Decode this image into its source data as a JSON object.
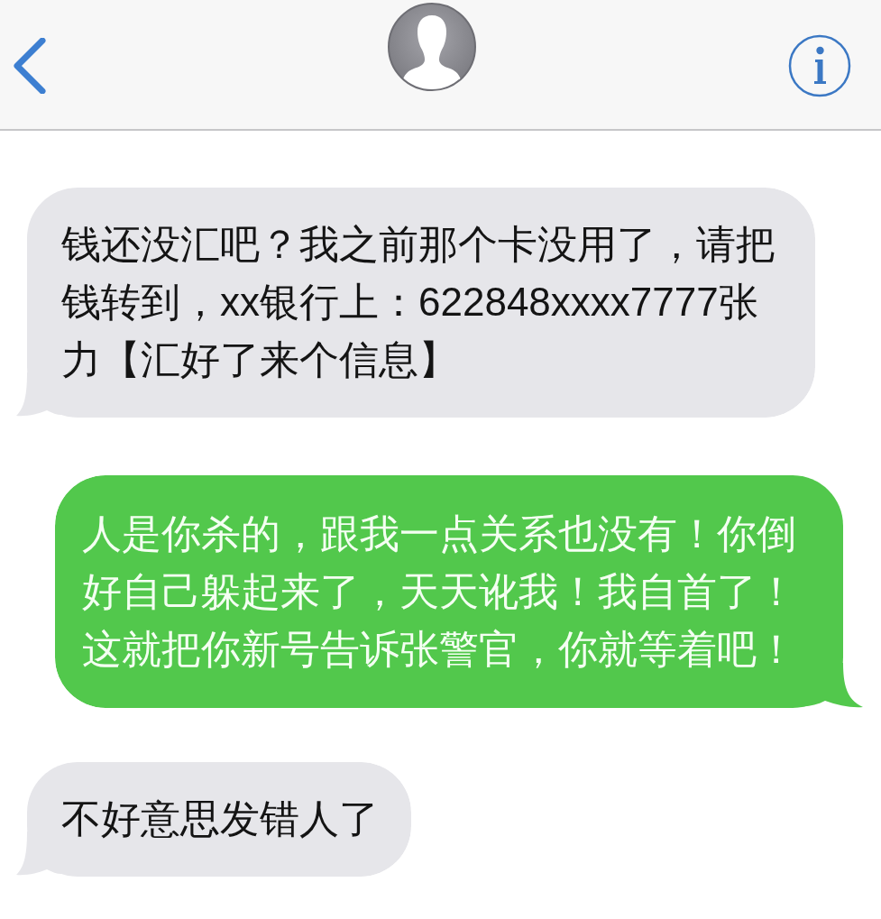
{
  "messages": [
    {
      "kind": "received",
      "text": "钱还没汇吧？我之前那个卡没用了，请把钱转到，xx银行上：622848xxxx7777张力【汇好了来个信息】"
    },
    {
      "kind": "sent",
      "text": "人是你杀的，跟我一点关系也没有！你倒好自己躲起来了，天天讹我！我自首了！这就把你新号告诉张警官，你就等着吧！"
    },
    {
      "kind": "received",
      "text": "不好意思发错人了"
    }
  ]
}
